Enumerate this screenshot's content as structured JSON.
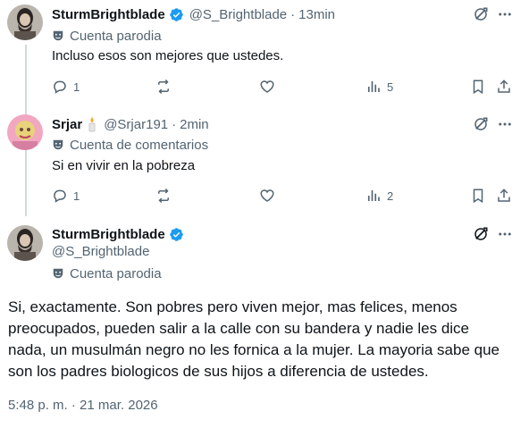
{
  "tweets": [
    {
      "name": "SturmBrightblade",
      "handle": "@S_Brightblade",
      "sep": "·",
      "time": "13min",
      "label": "Cuenta parodia",
      "text": "Incluso esos son mejores que ustedes.",
      "replies": "1",
      "views": "5"
    },
    {
      "name": "Srjar",
      "handle": "@Srjar191",
      "sep": "·",
      "time": "2min",
      "label": "Cuenta de comentarios",
      "text": "Si en vivir en la pobreza",
      "replies": "1",
      "views": "2"
    }
  ],
  "main_tweet": {
    "name": "SturmBrightblade",
    "handle": "@S_Brightblade",
    "label": "Cuenta parodia",
    "text_lines": [
      "Si, exactamente. Son pobres pero viven mejor, mas felices, menos",
      "preocupados, pueden salir a la calle con su bandera y nadie les dice",
      "nada, un musulmán negro no les fornica a la mujer. La mayoria sabe que",
      "son los padres biologicos de sus hijos a diferencia de ustedes."
    ],
    "timestamp": "5:48 p. m. · 21 mar. 2026"
  },
  "colors": {
    "verified": "#1d9bf0",
    "muted": "#536471",
    "text": "#0f1419",
    "line": "#cfd9de"
  }
}
